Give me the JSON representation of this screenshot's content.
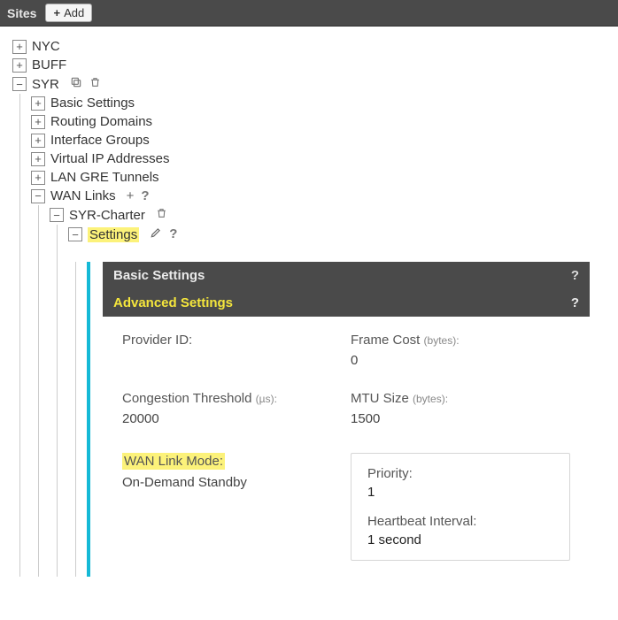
{
  "header": {
    "title": "Sites",
    "add_label": "Add"
  },
  "tree": {
    "nyc": "NYC",
    "buff": "BUFF",
    "syr": "SYR",
    "basic_settings": "Basic Settings",
    "routing_domains": "Routing Domains",
    "interface_groups": "Interface Groups",
    "virtual_ip": "Virtual IP Addresses",
    "lan_gre": "LAN GRE Tunnels",
    "wan_links": "WAN Links",
    "syr_charter": "SYR-Charter",
    "settings": "Settings"
  },
  "panel": {
    "basic_title": "Basic Settings",
    "advanced_title": "Advanced Settings",
    "provider_id_label": "Provider ID:",
    "provider_id_value": "",
    "frame_cost_label": "Frame Cost",
    "frame_cost_unit": "(bytes):",
    "frame_cost_value": "0",
    "congestion_label": "Congestion Threshold",
    "congestion_unit": "(µs):",
    "congestion_value": "20000",
    "mtu_label": "MTU Size",
    "mtu_unit": "(bytes):",
    "mtu_value": "1500",
    "wan_mode_label": "WAN Link Mode:",
    "wan_mode_value": "On-Demand Standby",
    "priority_label": "Priority:",
    "priority_value": "1",
    "heartbeat_label": "Heartbeat Interval:",
    "heartbeat_value": "1 second"
  }
}
